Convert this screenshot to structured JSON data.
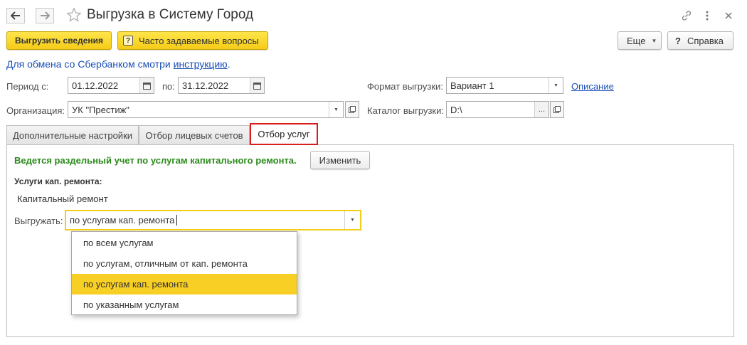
{
  "window": {
    "title": "Выгрузка в Систему Город",
    "back_icon": "arrow-left-icon",
    "forward_icon": "arrow-right-icon",
    "star_icon": "star-icon",
    "link_icon": "link-icon",
    "menu_icon": "more-vertical-icon",
    "close_icon": "close-icon"
  },
  "toolbar": {
    "upload_label": "Выгрузить сведения",
    "faq_label": "Часто задаваемые вопросы",
    "more_label": "Еще",
    "help_label": "Справка",
    "help_glyph": "?",
    "faq_glyph": "?"
  },
  "info": {
    "text_prefix": "Для обмена со Сбербанком смотри ",
    "link_text": "инструкцию",
    "text_suffix": "."
  },
  "form": {
    "period_label": "Период с:",
    "period_from": "01.12.2022",
    "period_to_label": "по:",
    "period_to": "31.12.2022",
    "format_label": "Формат выгрузки:",
    "format_value": "Вариант 1",
    "description_link": "Описание",
    "org_label": "Организация:",
    "org_value": "УК \"Престиж\"",
    "catalog_label": "Каталог выгрузки:",
    "catalog_value": "D:\\",
    "catalog_button": "..."
  },
  "tabs": [
    {
      "label": "Дополнительные настройки"
    },
    {
      "label": "Отбор лицевых счетов"
    },
    {
      "label": "Отбор услуг"
    }
  ],
  "panel": {
    "notice": "Ведется раздельный учет по услугам капитального ремонта.",
    "change_button": "Изменить",
    "services_heading": "Услуги кап. ремонта:",
    "services_value": "Капитальный ремонт",
    "export_label": "Выгружать:",
    "export_value": "по услугам кап. ремонта",
    "options": [
      "по всем услугам",
      "по услугам, отличным от кап. ремонта",
      "по услугам кап. ремонта",
      "по указанным услугам"
    ],
    "selected_index": 2
  },
  "colors": {
    "accent_yellow": "#f5cc17",
    "notice_green": "#2a8a1a",
    "active_tab_border": "#d91c1c",
    "link_blue": "#1a4fb8"
  }
}
